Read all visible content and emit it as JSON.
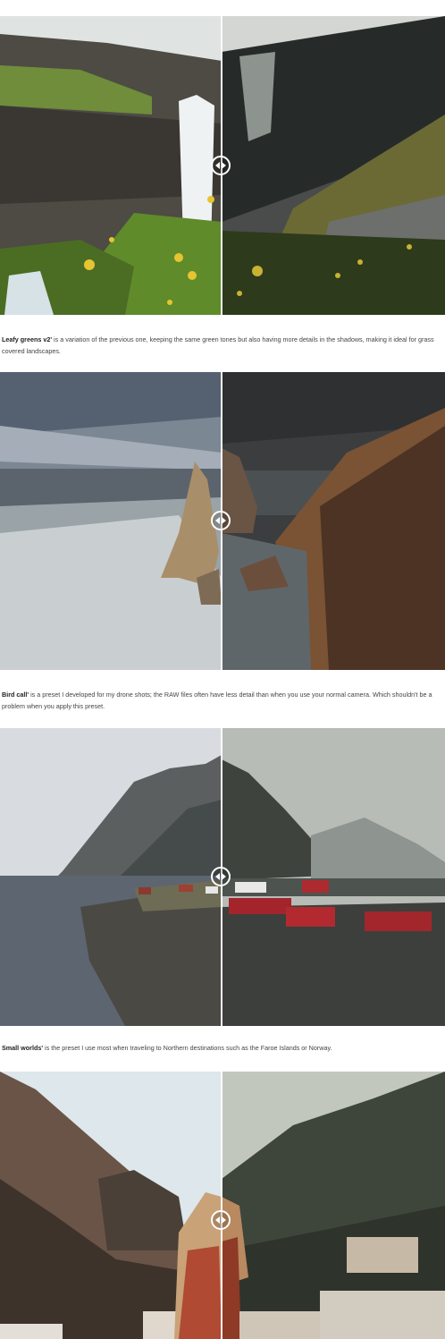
{
  "comparisons": [
    {
      "handle_icon": "compare-arrows-icon"
    },
    {
      "handle_icon": "compare-arrows-icon"
    },
    {
      "handle_icon": "compare-arrows-icon"
    },
    {
      "handle_icon": "compare-arrows-icon"
    }
  ],
  "captions": [
    {
      "name": "Leafy greens v2'",
      "text": " is a variation of the previous one, keeping the same green tones but also having more details in the shadows, making it ideal for grass covered landscapes."
    },
    {
      "name": "Bird call'",
      "text": " is a preset I developed for my drone shots; the RAW files often have less detail than when you use your normal camera. Which shouldn't be a problem when you apply this preset."
    },
    {
      "name": "Small worlds'",
      "text": " is the preset I use most when traveling to Northern destinations such as the Faroe Islands or Norway."
    }
  ],
  "colors": {
    "divider": "#ffffff",
    "caption_text": "#444444",
    "caption_bold": "#1f1f1f",
    "background": "#ffffff"
  }
}
